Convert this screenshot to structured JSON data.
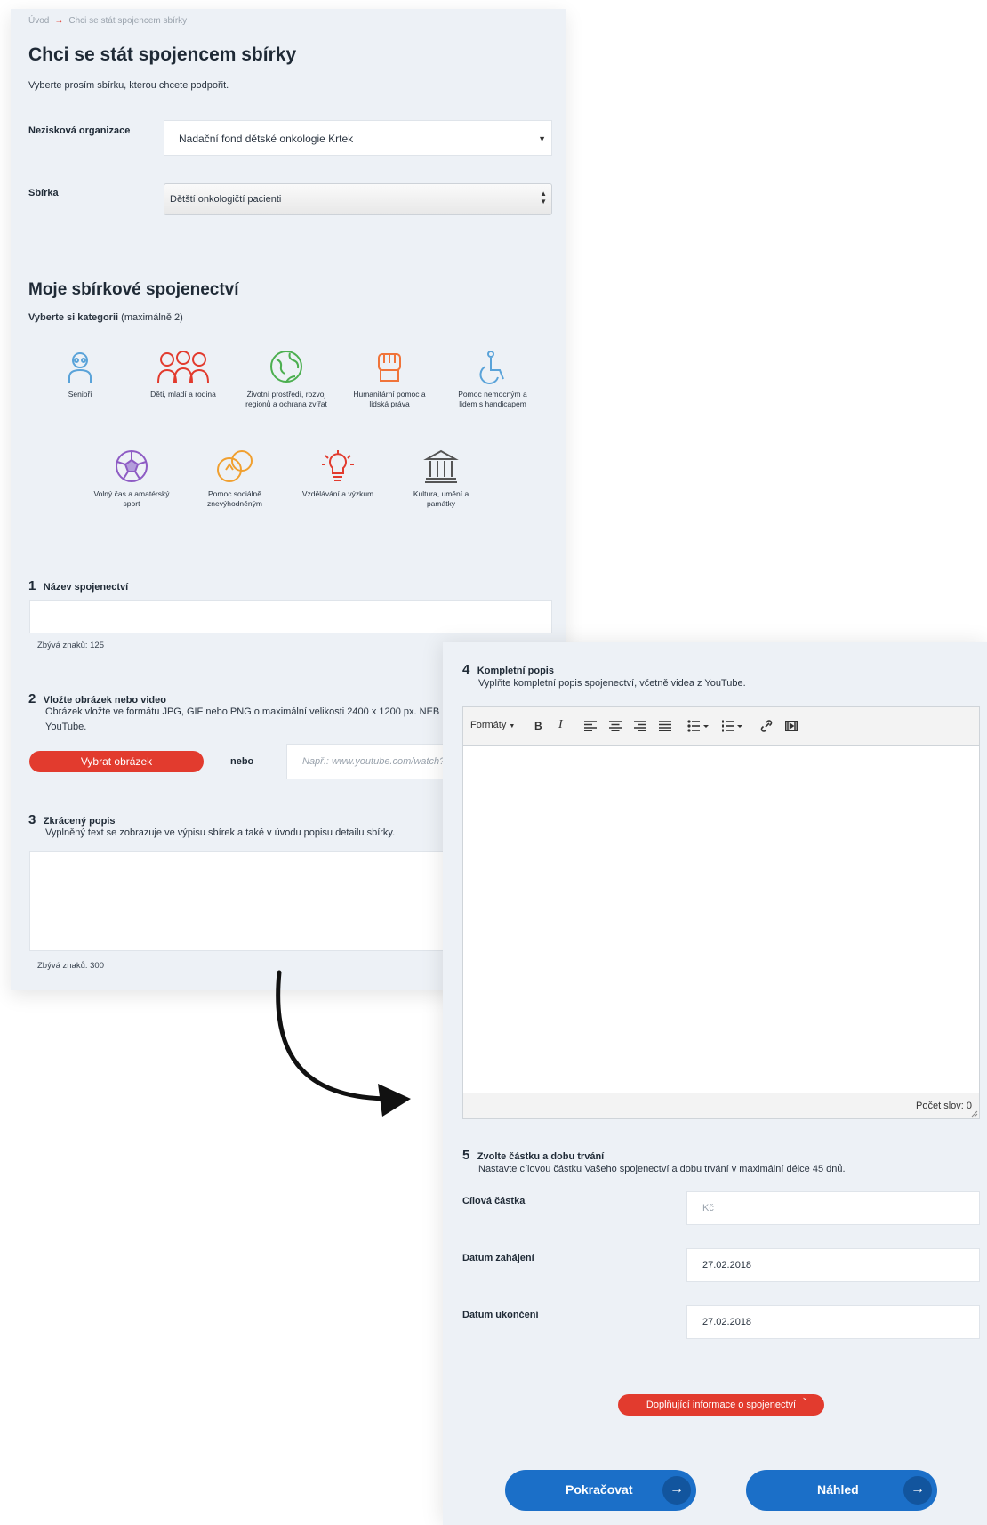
{
  "breadcrumb": {
    "home": "Úvod",
    "arrow": "→",
    "current": "Chci se stát spojencem sbírky"
  },
  "page_title": "Chci se stát spojencem sbírky",
  "intro": "Vyberte prosím sbírku, kterou chcete podpořit.",
  "org_label": "Nezisková organizace",
  "org_value": "Nadační fond dětské onkologie Krtek",
  "collection_label": "Sbírka",
  "collection_value": "Dětští onkologičtí pacienti",
  "section_title": "Moje sbírkové spojenectví",
  "categories_label": "Vyberte si kategorii",
  "categories_hint": "(maximálně 2)",
  "categories": [
    {
      "label": "Senioři",
      "icon": "senior-icon",
      "color": "#5aa3d9"
    },
    {
      "label": "Děti, mladí a rodina",
      "icon": "family-icon",
      "color": "#e23b2e"
    },
    {
      "label": "Životní prostředí, rozvoj regionů a ochrana zvířat",
      "icon": "globe-icon",
      "color": "#4caf50"
    },
    {
      "label": "Humanitární pomoc a lidská práva",
      "icon": "fist-icon",
      "color": "#f0743a"
    },
    {
      "label": "Pomoc nemocným a lidem s handicapem",
      "icon": "wheelchair-icon",
      "color": "#5aa3d9"
    },
    {
      "label": "Volný čas a amatérský sport",
      "icon": "ball-icon",
      "color": "#8e5cc4"
    },
    {
      "label": "Pomoc sociálně znevýhodněným",
      "icon": "coins-icon",
      "color": "#f0a030"
    },
    {
      "label": "Vzdělávání a výzkum",
      "icon": "bulb-icon",
      "color": "#e23b2e"
    },
    {
      "label": "Kultura, umění a památky",
      "icon": "museum-icon",
      "color": "#555555"
    }
  ],
  "step1": {
    "num": "1",
    "label": "Název spojenectví",
    "counter": "Zbývá znaků: 125"
  },
  "step2": {
    "num": "2",
    "label": "Vložte obrázek nebo video",
    "desc_line1": "Obrázek vložte ve formátu JPG, GIF nebo PNG o maximální velikosti 2400 x 1200 px. NEB",
    "desc_line2": "YouTube.",
    "button": "Vybrat obrázek",
    "or": "nebo",
    "url_placeholder": "Např.: www.youtube.com/watch?"
  },
  "step3": {
    "num": "3",
    "label": "Zkrácený popis",
    "desc": "Vyplněný text se zobrazuje ve výpisu sbírek a také v úvodu popisu detailu sbírky.",
    "counter": "Zbývá znaků: 300"
  },
  "step4": {
    "num": "4",
    "label": "Kompletní popis",
    "desc": "Vyplňte kompletní popis spojenectví, včetně videa z YouTube.",
    "toolbar": {
      "formats": "Formáty",
      "bold": "B",
      "italic": "I"
    },
    "word_count": "Počet slov: 0"
  },
  "step5": {
    "num": "5",
    "label": "Zvolte částku a dobu trvání",
    "desc": "Nastavte cílovou částku Vašeho spojenectví a dobu trvání v maximální délce 45 dnů.",
    "amount_label": "Cílová částka",
    "amount_placeholder": "Kč",
    "start_label": "Datum zahájení",
    "start_value": "27.02.2018",
    "end_label": "Datum ukončení",
    "end_value": "27.02.2018"
  },
  "extra_info_button": "Doplňující informace o spojenectví",
  "continue_button": "Pokračovat",
  "preview_button": "Náhled",
  "colors": {
    "accent_red": "#e23b2e",
    "primary_blue": "#1b6fc8",
    "panel_bg": "#edf1f6"
  }
}
